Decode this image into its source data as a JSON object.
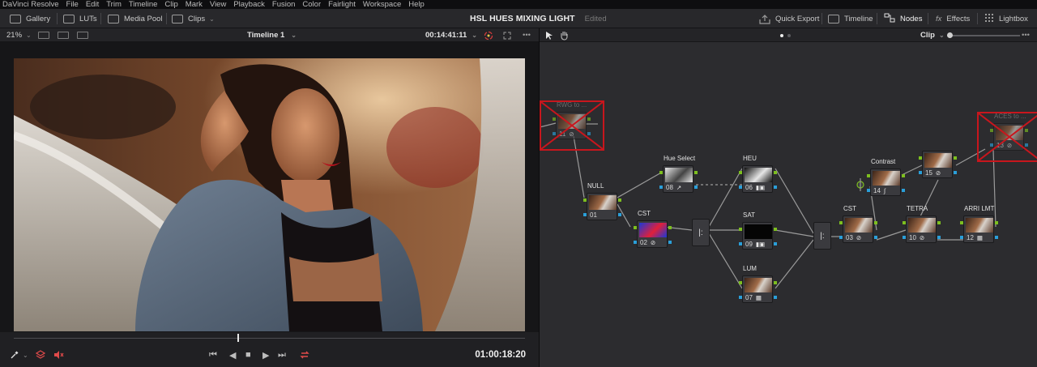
{
  "menu": [
    "DaVinci Resolve",
    "File",
    "Edit",
    "Trim",
    "Timeline",
    "Clip",
    "Mark",
    "View",
    "Playback",
    "Fusion",
    "Color",
    "Fairlight",
    "Workspace",
    "Help"
  ],
  "toolbar": {
    "gallery": "Gallery",
    "luts": "LUTs",
    "media_pool": "Media Pool",
    "clips": "Clips",
    "project_title": "HSL  HUES MIXING LIGHT",
    "edited": "Edited",
    "quick_export": "Quick Export",
    "timeline": "Timeline",
    "nodes": "Nodes",
    "effects": "Effects",
    "lightbox": "Lightbox"
  },
  "viewer": {
    "zoom": "21%",
    "timeline_name": "Timeline 1",
    "source_timecode": "00:14:41:11",
    "record_timecode": "01:00:18:20",
    "playhead_fraction": 0.437
  },
  "node_editor": {
    "mode": "Clip"
  },
  "nodes": [
    {
      "id": "11",
      "label": "RWG to ...",
      "icon": "disabled-icon",
      "disabled": true
    },
    {
      "id": "01",
      "label": "NULL",
      "icon": ""
    },
    {
      "id": "08",
      "label": "Hue Select",
      "icon": "eyedropper-icon"
    },
    {
      "id": "02",
      "label": "CST",
      "icon": "disabled-icon"
    },
    {
      "id": "06",
      "label": "HEU",
      "icon": "curves-key-icon"
    },
    {
      "id": "09",
      "label": "SAT",
      "icon": "curves-key-icon"
    },
    {
      "id": "07",
      "label": "LUM",
      "icon": "key-icon"
    },
    {
      "id": "03",
      "label": "CST",
      "icon": "disabled-icon"
    },
    {
      "id": "14",
      "label": "Contrast",
      "icon": "curve-icon"
    },
    {
      "id": "15",
      "label": "",
      "icon": "disabled-icon"
    },
    {
      "id": "10",
      "label": "TETRA",
      "icon": "disabled-icon"
    },
    {
      "id": "12",
      "label": "ARRI LMT",
      "icon": "lut-icon"
    },
    {
      "id": "13",
      "label": "ACES to ...",
      "icon": "disabled-icon",
      "disabled": true
    }
  ]
}
